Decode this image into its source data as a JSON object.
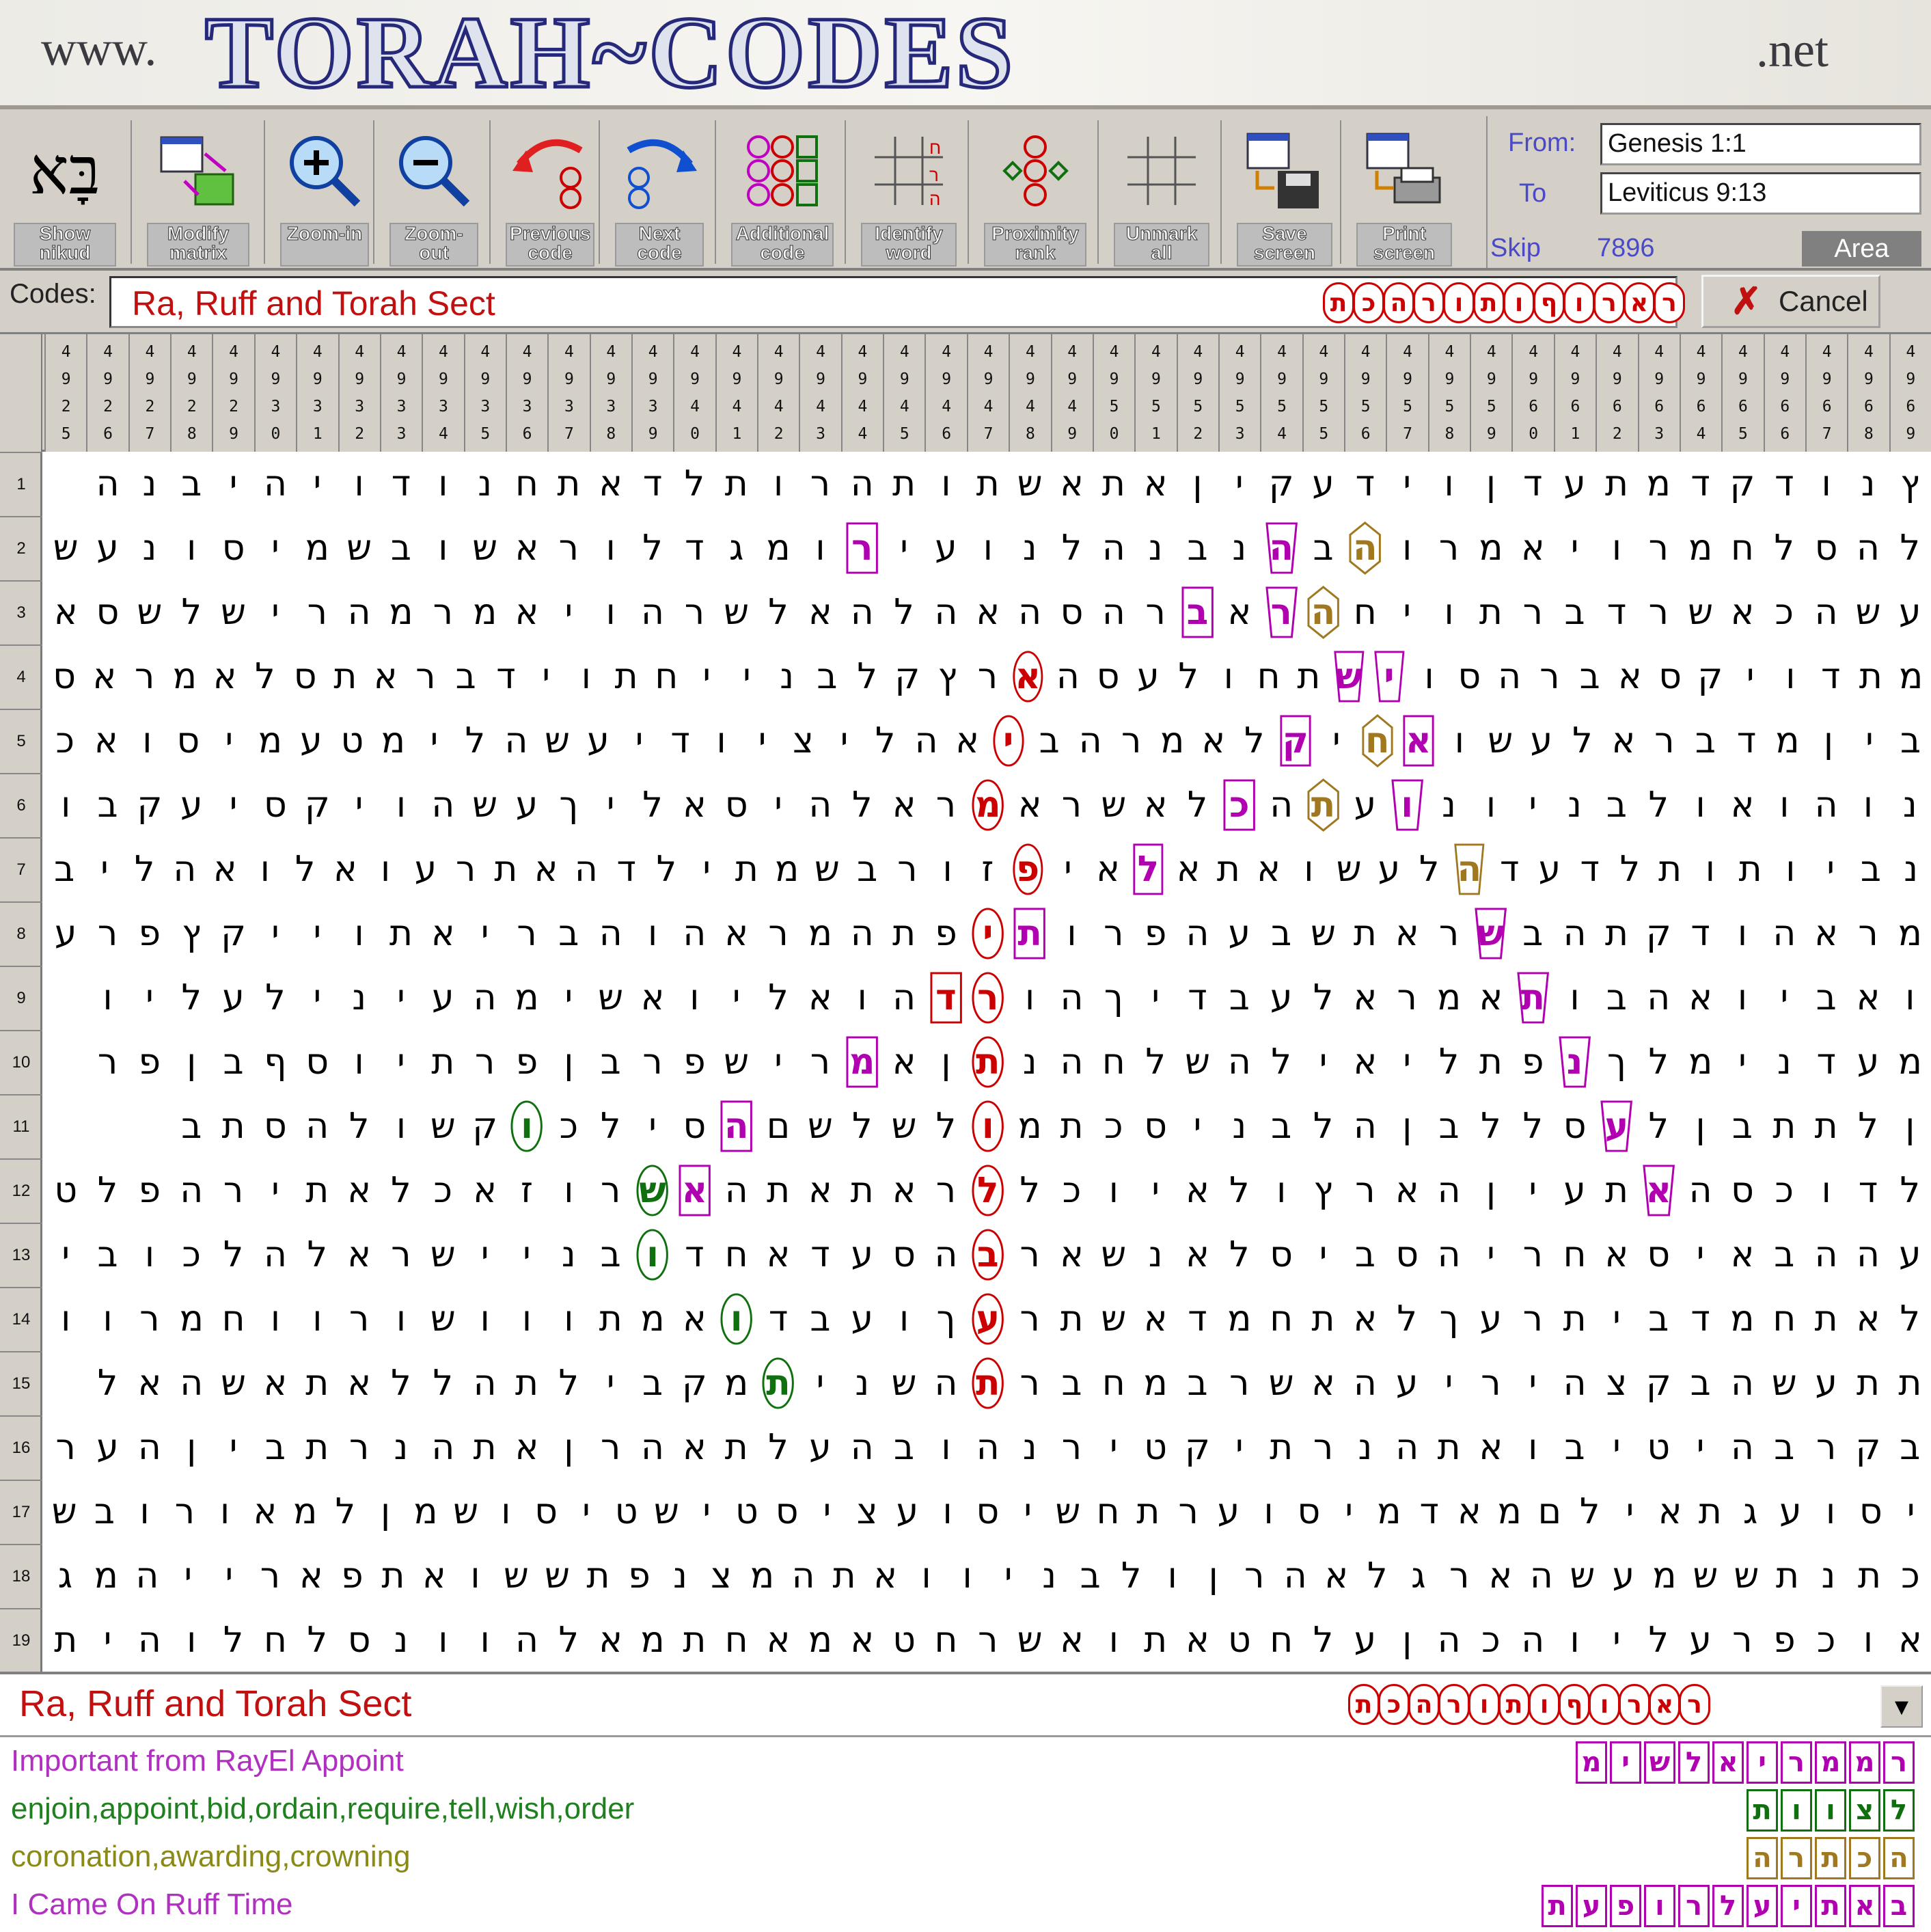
{
  "banner": {
    "prefix": "www.",
    "brand": "TORAH~CODES",
    "suffix": ".net"
  },
  "toolbar": {
    "buttons": [
      {
        "key": "show-nikud",
        "label": "Show\nnikud"
      },
      {
        "key": "modify-matrix",
        "label": "Modify\nmatrix"
      },
      {
        "key": "zoom-in",
        "label": "Zoom-in"
      },
      {
        "key": "zoom-out",
        "label": "Zoom-out"
      },
      {
        "key": "previous-code",
        "label": "Previous\ncode"
      },
      {
        "key": "next-code",
        "label": "Next\ncode"
      },
      {
        "key": "additional-code",
        "label": "Additional\ncode"
      },
      {
        "key": "identify-word",
        "label": "Identify\nword"
      },
      {
        "key": "proximity-rank",
        "label": "Proximity\nrank"
      },
      {
        "key": "unmark-all",
        "label": "Unmark\nall"
      },
      {
        "key": "save-screen",
        "label": "Save\nscreen"
      },
      {
        "key": "print-screen",
        "label": "Print\nscreen"
      }
    ],
    "icons": [
      "hebrew-letter-icon",
      "matrix-grid-icon",
      "zoom-in-icon",
      "zoom-out-icon",
      "previous-arrow-icon",
      "next-arrow-icon",
      "additional-code-icon",
      "identify-word-icon",
      "proximity-icon",
      "unmark-icon",
      "save-disk-icon",
      "printer-icon"
    ],
    "show_nikud_glyph": "בָּא",
    "from_label": "From:",
    "from_value": "Genesis 1:1",
    "to_label": "To",
    "to_value": "Leviticus 9:13",
    "skip_label": "Skip",
    "skip_value": "7896",
    "area_label": "Area"
  },
  "codes": {
    "label": "Codes:",
    "value": "Ra, Ruff and Torah Sect",
    "letters": [
      "ר",
      "א",
      "ר",
      "ו",
      "ף",
      "ו",
      "ת",
      "ו",
      "ר",
      "ה",
      "כ",
      "ת"
    ],
    "dropdown": "▼",
    "cancel_label": "Cancel"
  },
  "columns": [
    "4969",
    "4968",
    "4967",
    "4966",
    "4965",
    "4964",
    "4963",
    "4962",
    "4961",
    "4960",
    "4959",
    "4958",
    "4957",
    "4956",
    "4955",
    "4954",
    "4953",
    "4952",
    "4951",
    "4950",
    "4949",
    "4948",
    "4947",
    "4946",
    "4945",
    "4944",
    "4943",
    "4942",
    "4941",
    "4940",
    "4939",
    "4938",
    "4937",
    "4936",
    "4935",
    "4934",
    "4933",
    "4932",
    "4931",
    "4930",
    "4929",
    "4928",
    "4927",
    "4926",
    "4925"
  ],
  "rows": [
    "ץנודקדמתעדןוידעקיןאתאשתותהרותלדאתחנודויהיבנה",
    "להסלחמרויאמרוהבהנבנהלנועירומגדלוראשובשמיסונעש",
    "עשהכאשרדברתויחהראברהסהאהלהאלשרהויאמרמהרישלשסא",
    "מתדויקסאברהסוישתחולעסהארץקלבנייחתוידבראתסלאמראס",
    "ביןמדבראלעשואחיקלאמרהביאהליציודיעשהלימטעמיסואכ",
    "נוהואולבניונועתהכלאשראמראלהיסאליךעשהויקסיעקבו",
    "נביותותלדעדהלעשואתאלאיפזורבשמתילדהאתרעואלואהליב",
    "מראהודקתהבשראתשבעהפרותיפתהמראהוהבריאתוייקץפרע",
    "ואביואהבותאמראלעבדיךהורדהואליואשימהעינילעליו",
    "מעדנימלךנפתליאילהשלחהנתןאמרישפרבןפרתיוסףבןפר",
    "ןלתתבןלעסללבןהלבניסכתמולשלשםהסילכוקשולהסתב",
    "לדוכסהאתעיןהארץולאיוכללראתאתהאשרוזאכלאתירהפלט",
    "עההבאיסאחריהסביסלאנשארבהסעדאחדובניישראלהלכובי",
    "לאתחמדביתרעךלאתחמדאשתרעךועבדואמתווושורווחמרוו",
    "תתעשהבקצהיריעהאשרבמחברתהשניתמקבילתהללאתאשהאל",
    "בקרבהיטיבואתהנרתיקטירנהובהעלתאהרןאתהנרתביןהער",
    "יסועגתאילםמאדמיסוערתחשיסועציסטישטיסושמןלמאורובש",
    "כתנתששמעשהארגלאהרןולבניוואתהמצנפתששואתפארייהמג",
    "אוכפרעליוהכהןעלחטאתואשרחטאמאחתמאלהוונסלחלוהית"
  ],
  "highlights": [
    {
      "r": 2,
      "c": 14,
      "ch": "ה",
      "color": "#a07820",
      "shape": "hex"
    },
    {
      "r": 2,
      "c": 16,
      "ch": "ב",
      "color": "#b000b0",
      "shape": "cup"
    },
    {
      "r": 2,
      "c": 26,
      "ch": "מ",
      "color": "#b000b0",
      "shape": "rect"
    },
    {
      "r": 3,
      "c": 15,
      "ch": "ר",
      "color": "#a07820",
      "shape": "hex"
    },
    {
      "r": 3,
      "c": 16,
      "ch": "א",
      "color": "#b000b0",
      "shape": "cup"
    },
    {
      "r": 3,
      "c": 18,
      "ch": "י",
      "color": "#b000b0",
      "shape": "rect"
    },
    {
      "r": 4,
      "c": 15,
      "ch": "ת",
      "color": "#b000b0",
      "shape": "cup"
    },
    {
      "r": 4,
      "c": 14,
      "ch": "ש",
      "color": "#b000b0",
      "shape": "cup"
    },
    {
      "r": 4,
      "c": 23,
      "ch": "ר",
      "color": "#cc0000",
      "shape": "oval"
    },
    {
      "r": 5,
      "c": 14,
      "ch": "ק",
      "color": "#a07820",
      "shape": "hex"
    },
    {
      "r": 5,
      "c": 13,
      "ch": "י",
      "color": "#b000b0",
      "shape": "rect"
    },
    {
      "r": 5,
      "c": 16,
      "ch": "ל",
      "color": "#b000b0",
      "shape": "rect"
    },
    {
      "r": 5,
      "c": 23,
      "ch": "א",
      "color": "#cc0000",
      "shape": "oval"
    },
    {
      "r": 6,
      "c": 15,
      "ch": "ה",
      "color": "#a07820",
      "shape": "hex"
    },
    {
      "r": 6,
      "c": 13,
      "ch": "ע",
      "color": "#b000b0",
      "shape": "cup"
    },
    {
      "r": 6,
      "c": 17,
      "ch": "א",
      "color": "#b000b0",
      "shape": "rect"
    },
    {
      "r": 6,
      "c": 23,
      "ch": "ר",
      "color": "#cc0000",
      "shape": "oval"
    },
    {
      "r": 7,
      "c": 12,
      "ch": "ל",
      "color": "#a07820",
      "shape": "cup"
    },
    {
      "r": 7,
      "c": 20,
      "ch": "י",
      "color": "#b000b0",
      "shape": "rect"
    },
    {
      "r": 7,
      "c": 23,
      "ch": "ו",
      "color": "#cc0000",
      "shape": "oval"
    },
    {
      "r": 8,
      "c": 11,
      "ch": "ר",
      "color": "#b000b0",
      "shape": "cup"
    },
    {
      "r": 8,
      "c": 22,
      "ch": "י",
      "color": "#b000b0",
      "shape": "rect"
    },
    {
      "r": 8,
      "c": 23,
      "ch": "פ",
      "color": "#cc0000",
      "shape": "oval"
    },
    {
      "r": 9,
      "c": 10,
      "ch": "ו",
      "color": "#b000b0",
      "shape": "cup"
    },
    {
      "r": 9,
      "c": 23,
      "ch": "ו",
      "color": "#cc0000",
      "shape": "oval"
    },
    {
      "r": 9,
      "c": 24,
      "ch": "ר",
      "color": "#cc0000",
      "shape": "rect"
    },
    {
      "r": 10,
      "c": 9,
      "ch": "פ",
      "color": "#b000b0",
      "shape": "cup"
    },
    {
      "r": 10,
      "c": 23,
      "ch": "ת",
      "color": "#cc0000",
      "shape": "oval"
    },
    {
      "r": 10,
      "c": 26,
      "ch": "מ",
      "color": "#b000b0",
      "shape": "rect"
    },
    {
      "r": 11,
      "c": 8,
      "ch": "ע",
      "color": "#b000b0",
      "shape": "cup"
    },
    {
      "r": 11,
      "c": 23,
      "ch": "ו",
      "color": "#cc0000",
      "shape": "oval"
    },
    {
      "r": 11,
      "c": 29,
      "ch": "ם",
      "color": "#b000b0",
      "shape": "rect"
    },
    {
      "r": 11,
      "c": 34,
      "ch": "ל",
      "color": "#107010",
      "shape": "oval"
    },
    {
      "r": 12,
      "c": 7,
      "ch": "ת",
      "color": "#b000b0",
      "shape": "cup"
    },
    {
      "r": 12,
      "c": 23,
      "ch": "ר",
      "color": "#cc0000",
      "shape": "oval"
    },
    {
      "r": 12,
      "c": 30,
      "ch": "ר",
      "color": "#b000b0",
      "shape": "rect"
    },
    {
      "r": 12,
      "c": 31,
      "ch": "ץ",
      "color": "#107010",
      "shape": "oval"
    },
    {
      "r": 13,
      "c": 23,
      "ch": "ה",
      "color": "#cc0000",
      "shape": "oval"
    },
    {
      "r": 13,
      "c": 31,
      "ch": "ו",
      "color": "#107010",
      "shape": "oval"
    },
    {
      "r": 14,
      "c": 23,
      "ch": "ך",
      "color": "#cc0000",
      "shape": "oval"
    },
    {
      "r": 14,
      "c": 29,
      "ch": "ו",
      "color": "#107010",
      "shape": "oval"
    },
    {
      "r": 15,
      "c": 23,
      "ch": "ת",
      "color": "#cc0000",
      "shape": "oval"
    },
    {
      "r": 15,
      "c": 28,
      "ch": "ת",
      "color": "#107010",
      "shape": "oval"
    }
  ],
  "bottom": {
    "code_value": "Ra, Ruff and Torah Sect",
    "legends": [
      {
        "text": "Important from RayEl Appoint",
        "color": "#b030c0",
        "letters": [
          "ר",
          "מ",
          "מ",
          "ר",
          "י",
          "א",
          "ל",
          "ש",
          "י",
          "מ"
        ],
        "box": "#b000b0"
      },
      {
        "text": "enjoin,appoint,bid,ordain,require,tell,wish,order",
        "color": "#208020",
        "letters": [
          "ל",
          "צ",
          "ו",
          "ו",
          "ת"
        ],
        "box": "#107010"
      },
      {
        "text": "coronation,awarding,crowning",
        "color": "#8a8a18",
        "letters": [
          "ה",
          "כ",
          "ת",
          "ר",
          "ה"
        ],
        "box": "#a07820"
      },
      {
        "text": "I Came On Ruff Time",
        "color": "#b030c0",
        "letters": [
          "ב",
          "א",
          "ת",
          "י",
          "ע",
          "ל",
          "ר",
          "ו",
          "פ",
          "ע",
          "ת"
        ],
        "box": "#b000b0"
      }
    ]
  }
}
